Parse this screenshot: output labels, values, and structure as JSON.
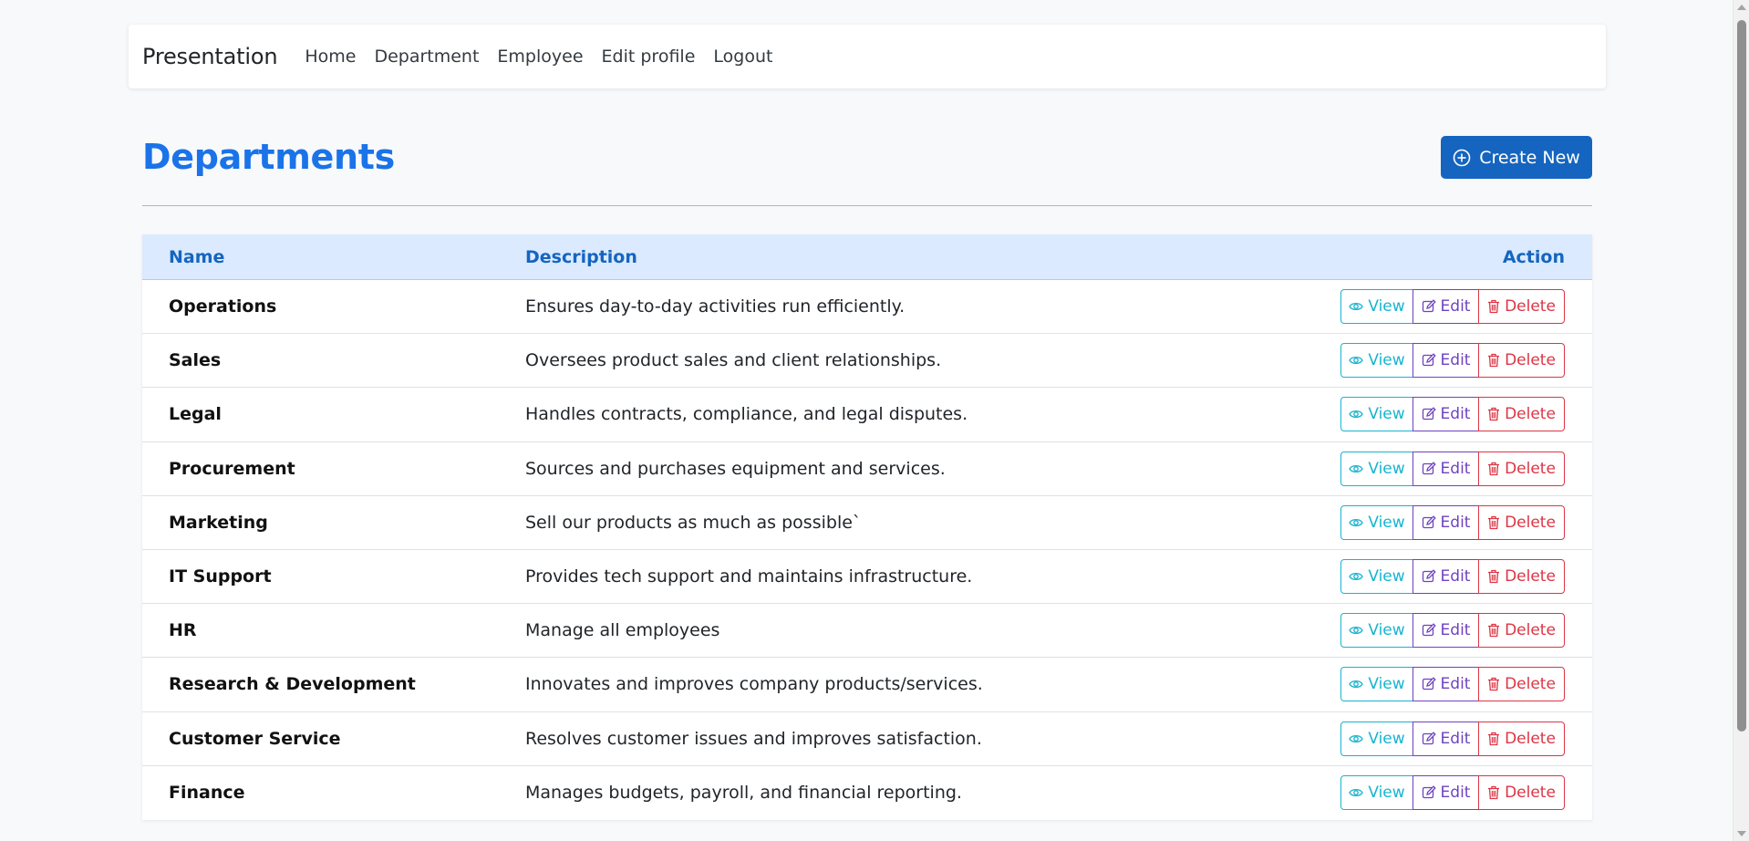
{
  "navbar": {
    "brand": "Presentation",
    "links": [
      "Home",
      "Department",
      "Employee",
      "Edit profile",
      "Logout"
    ]
  },
  "page": {
    "title": "Departments",
    "create_label": "Create New"
  },
  "table": {
    "headers": {
      "name": "Name",
      "description": "Description",
      "action": "Action"
    },
    "actions": {
      "view": "View",
      "edit": "Edit",
      "delete": "Delete"
    },
    "rows": [
      {
        "name": "Operations",
        "description": "Ensures day-to-day activities run efficiently."
      },
      {
        "name": "Sales",
        "description": "Oversees product sales and client relationships."
      },
      {
        "name": "Legal",
        "description": "Handles contracts, compliance, and legal disputes."
      },
      {
        "name": "Procurement",
        "description": "Sources and purchases equipment and services."
      },
      {
        "name": "Marketing",
        "description": "Sell our products as much as possible`"
      },
      {
        "name": "IT Support",
        "description": "Provides tech support and maintains infrastructure."
      },
      {
        "name": "HR",
        "description": "Manage all employees"
      },
      {
        "name": "Research & Development",
        "description": "Innovates and improves company products/services."
      },
      {
        "name": "Customer Service",
        "description": "Resolves customer issues and improves satisfaction."
      },
      {
        "name": "Finance",
        "description": "Manages budgets, payroll, and financial reporting."
      }
    ]
  },
  "colors": {
    "primary": "#1565c0",
    "title": "#1a73e8",
    "view": "#17b4cf",
    "edit": "#6f42c1",
    "delete": "#dc3545",
    "header_bg": "#dbeafe"
  },
  "icons": {
    "create": "plus-circle-icon",
    "view": "eye-icon",
    "edit": "edit-icon",
    "delete": "trash-icon"
  }
}
